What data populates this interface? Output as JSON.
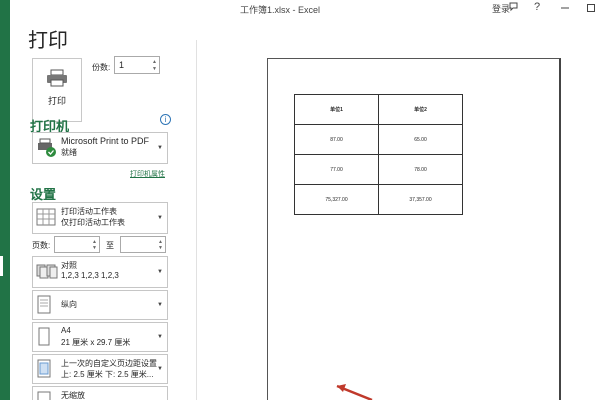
{
  "window": {
    "title": "工作簿1.xlsx - Excel",
    "login_label": "登录",
    "help_label": "?"
  },
  "backstage": {
    "page_title": "打印",
    "print_button_label": "打印",
    "copies_label": "份数:",
    "copies_value": "1",
    "printer": {
      "section_title": "打印机",
      "name": "Microsoft Print to PDF",
      "status": "就绪",
      "properties_link": "打印机属性"
    },
    "settings": {
      "section_title": "设置",
      "print_what": {
        "line1": "打印活动工作表",
        "line2": "仅打印活动工作表"
      },
      "pages_label": "页数:",
      "pages_from": "",
      "pages_to_label": "至",
      "pages_to": "",
      "collation": {
        "line1": "对照",
        "line2": "1,2,3    1,2,3    1,2,3"
      },
      "orientation": {
        "line1": "纵向"
      },
      "paper_size": {
        "line1": "A4",
        "line2": "21 厘米 x 29.7 厘米"
      },
      "margins": {
        "line1": "上一次的自定义页边距设置",
        "line2": "上: 2.5 厘米 下: 2.5 厘米..."
      },
      "scaling": {
        "line1": "无缩放"
      }
    }
  },
  "preview": {
    "table": [
      [
        "单位1",
        "单位2"
      ],
      [
        "87.00",
        "65.00"
      ],
      [
        "77.00",
        "78.00"
      ],
      [
        "75,327.00",
        "37,357.00"
      ]
    ]
  },
  "colors": {
    "accent": "#217346",
    "link": "#2e75b6",
    "arrow": "#c0392b"
  }
}
